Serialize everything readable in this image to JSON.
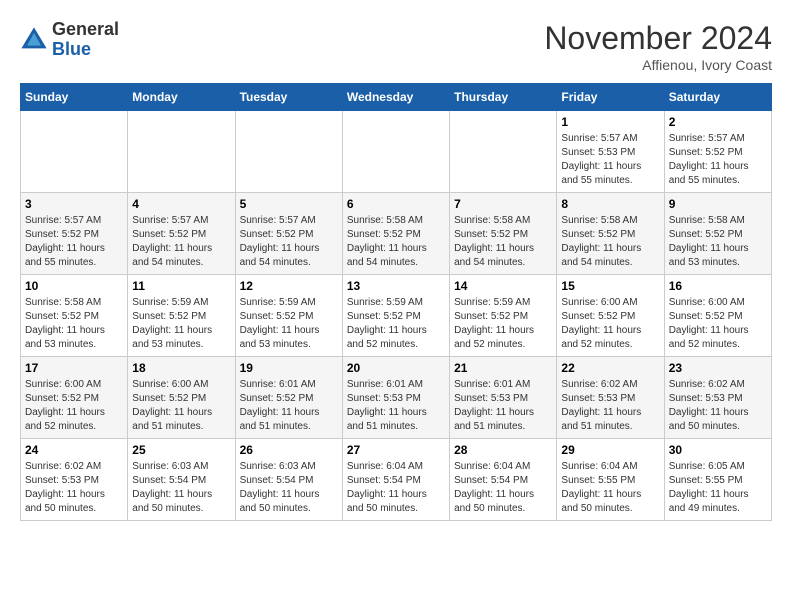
{
  "header": {
    "logo_general": "General",
    "logo_blue": "Blue",
    "month_year": "November 2024",
    "location": "Affienou, Ivory Coast"
  },
  "weekdays": [
    "Sunday",
    "Monday",
    "Tuesday",
    "Wednesday",
    "Thursday",
    "Friday",
    "Saturday"
  ],
  "weeks": [
    [
      {
        "day": "",
        "info": ""
      },
      {
        "day": "",
        "info": ""
      },
      {
        "day": "",
        "info": ""
      },
      {
        "day": "",
        "info": ""
      },
      {
        "day": "",
        "info": ""
      },
      {
        "day": "1",
        "info": "Sunrise: 5:57 AM\nSunset: 5:53 PM\nDaylight: 11 hours and 55 minutes."
      },
      {
        "day": "2",
        "info": "Sunrise: 5:57 AM\nSunset: 5:52 PM\nDaylight: 11 hours and 55 minutes."
      }
    ],
    [
      {
        "day": "3",
        "info": "Sunrise: 5:57 AM\nSunset: 5:52 PM\nDaylight: 11 hours and 55 minutes."
      },
      {
        "day": "4",
        "info": "Sunrise: 5:57 AM\nSunset: 5:52 PM\nDaylight: 11 hours and 54 minutes."
      },
      {
        "day": "5",
        "info": "Sunrise: 5:57 AM\nSunset: 5:52 PM\nDaylight: 11 hours and 54 minutes."
      },
      {
        "day": "6",
        "info": "Sunrise: 5:58 AM\nSunset: 5:52 PM\nDaylight: 11 hours and 54 minutes."
      },
      {
        "day": "7",
        "info": "Sunrise: 5:58 AM\nSunset: 5:52 PM\nDaylight: 11 hours and 54 minutes."
      },
      {
        "day": "8",
        "info": "Sunrise: 5:58 AM\nSunset: 5:52 PM\nDaylight: 11 hours and 54 minutes."
      },
      {
        "day": "9",
        "info": "Sunrise: 5:58 AM\nSunset: 5:52 PM\nDaylight: 11 hours and 53 minutes."
      }
    ],
    [
      {
        "day": "10",
        "info": "Sunrise: 5:58 AM\nSunset: 5:52 PM\nDaylight: 11 hours and 53 minutes."
      },
      {
        "day": "11",
        "info": "Sunrise: 5:59 AM\nSunset: 5:52 PM\nDaylight: 11 hours and 53 minutes."
      },
      {
        "day": "12",
        "info": "Sunrise: 5:59 AM\nSunset: 5:52 PM\nDaylight: 11 hours and 53 minutes."
      },
      {
        "day": "13",
        "info": "Sunrise: 5:59 AM\nSunset: 5:52 PM\nDaylight: 11 hours and 52 minutes."
      },
      {
        "day": "14",
        "info": "Sunrise: 5:59 AM\nSunset: 5:52 PM\nDaylight: 11 hours and 52 minutes."
      },
      {
        "day": "15",
        "info": "Sunrise: 6:00 AM\nSunset: 5:52 PM\nDaylight: 11 hours and 52 minutes."
      },
      {
        "day": "16",
        "info": "Sunrise: 6:00 AM\nSunset: 5:52 PM\nDaylight: 11 hours and 52 minutes."
      }
    ],
    [
      {
        "day": "17",
        "info": "Sunrise: 6:00 AM\nSunset: 5:52 PM\nDaylight: 11 hours and 52 minutes."
      },
      {
        "day": "18",
        "info": "Sunrise: 6:00 AM\nSunset: 5:52 PM\nDaylight: 11 hours and 51 minutes."
      },
      {
        "day": "19",
        "info": "Sunrise: 6:01 AM\nSunset: 5:52 PM\nDaylight: 11 hours and 51 minutes."
      },
      {
        "day": "20",
        "info": "Sunrise: 6:01 AM\nSunset: 5:53 PM\nDaylight: 11 hours and 51 minutes."
      },
      {
        "day": "21",
        "info": "Sunrise: 6:01 AM\nSunset: 5:53 PM\nDaylight: 11 hours and 51 minutes."
      },
      {
        "day": "22",
        "info": "Sunrise: 6:02 AM\nSunset: 5:53 PM\nDaylight: 11 hours and 51 minutes."
      },
      {
        "day": "23",
        "info": "Sunrise: 6:02 AM\nSunset: 5:53 PM\nDaylight: 11 hours and 50 minutes."
      }
    ],
    [
      {
        "day": "24",
        "info": "Sunrise: 6:02 AM\nSunset: 5:53 PM\nDaylight: 11 hours and 50 minutes."
      },
      {
        "day": "25",
        "info": "Sunrise: 6:03 AM\nSunset: 5:54 PM\nDaylight: 11 hours and 50 minutes."
      },
      {
        "day": "26",
        "info": "Sunrise: 6:03 AM\nSunset: 5:54 PM\nDaylight: 11 hours and 50 minutes."
      },
      {
        "day": "27",
        "info": "Sunrise: 6:04 AM\nSunset: 5:54 PM\nDaylight: 11 hours and 50 minutes."
      },
      {
        "day": "28",
        "info": "Sunrise: 6:04 AM\nSunset: 5:54 PM\nDaylight: 11 hours and 50 minutes."
      },
      {
        "day": "29",
        "info": "Sunrise: 6:04 AM\nSunset: 5:55 PM\nDaylight: 11 hours and 50 minutes."
      },
      {
        "day": "30",
        "info": "Sunrise: 6:05 AM\nSunset: 5:55 PM\nDaylight: 11 hours and 49 minutes."
      }
    ]
  ]
}
